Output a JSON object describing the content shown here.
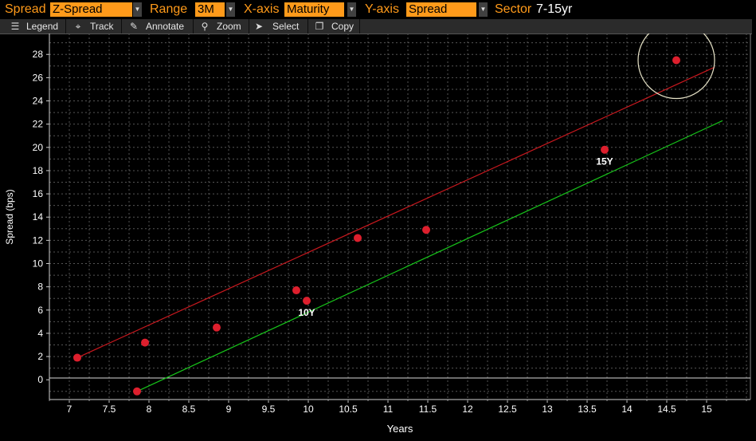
{
  "controls": {
    "spread_label": "Spread",
    "spread_value": "Z-Spread",
    "range_label": "Range",
    "range_value": "3M",
    "xaxis_label": "X-axis",
    "xaxis_value": "Maturity",
    "yaxis_label": "Y-axis",
    "yaxis_value": "Spread",
    "sector_label": "Sector",
    "sector_value": "7-15yr"
  },
  "toolbar": {
    "legend": "Legend",
    "track": "Track",
    "annotate": "Annotate",
    "zoom": "Zoom",
    "select": "Select",
    "copy": "Copy"
  },
  "colors": {
    "accent": "#ff9a1a",
    "point": "#dd1f2d",
    "upper_line": "#c8181e",
    "lower_line": "#17c41a",
    "circle": "#e8e4c8",
    "grid": "#555555"
  },
  "chart_data": {
    "type": "scatter",
    "xlabel": "Years",
    "ylabel": "Spread (bps)",
    "xlim": [
      6.75,
      15.55
    ],
    "ylim": [
      -1.7,
      29.8
    ],
    "x_ticks": [
      "7",
      "7.5",
      "8",
      "8.5",
      "9",
      "9.5",
      "10",
      "10.5",
      "11",
      "11.5",
      "12",
      "12.5",
      "13",
      "13.5",
      "14",
      "14.5",
      "15"
    ],
    "y_ticks": [
      "0",
      "2",
      "4",
      "6",
      "8",
      "10",
      "12",
      "14",
      "16",
      "18",
      "20",
      "22",
      "24",
      "26",
      "28"
    ],
    "grid": true,
    "legend": "none",
    "points": [
      {
        "x": 7.1,
        "y": 1.9,
        "label": ""
      },
      {
        "x": 7.85,
        "y": -1.0,
        "label": ""
      },
      {
        "x": 7.95,
        "y": 3.2,
        "label": ""
      },
      {
        "x": 8.85,
        "y": 4.5,
        "label": ""
      },
      {
        "x": 9.85,
        "y": 7.7,
        "label": ""
      },
      {
        "x": 9.98,
        "y": 6.8,
        "label": "10Y"
      },
      {
        "x": 10.62,
        "y": 12.2,
        "label": ""
      },
      {
        "x": 11.48,
        "y": 12.9,
        "label": ""
      },
      {
        "x": 13.72,
        "y": 19.8,
        "label": "15Y"
      },
      {
        "x": 14.62,
        "y": 27.5,
        "label": ""
      }
    ],
    "lines": [
      {
        "x": [
          7.1,
          15.1
        ],
        "y": [
          1.9,
          26.9
        ]
      },
      {
        "x": [
          7.85,
          15.2
        ],
        "y": [
          -1.0,
          22.3
        ]
      }
    ],
    "highlight": {
      "x": 14.62,
      "y": 27.5
    }
  }
}
